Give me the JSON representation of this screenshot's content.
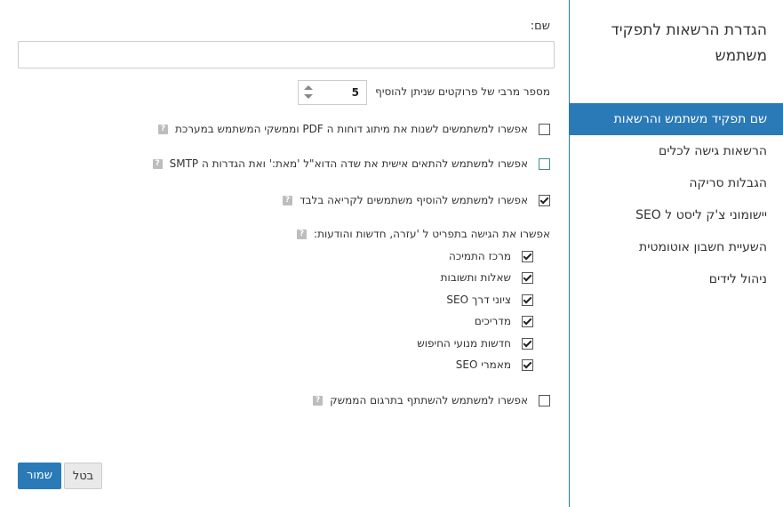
{
  "sidebar": {
    "title": "הגדרת הרשאות לתפקיד משתמש",
    "items": [
      {
        "label": "שם תפקיד משתמש והרשאות",
        "active": true
      },
      {
        "label": "הרשאות גישה לכלים",
        "active": false
      },
      {
        "label": "הגבלות סריקה",
        "active": false
      },
      {
        "label": "יישומוני צ'ק ליסט ל SEO",
        "active": false
      },
      {
        "label": "השעיית חשבון אוטומטית",
        "active": false
      },
      {
        "label": "ניהול לידים",
        "active": false
      }
    ]
  },
  "form": {
    "name_label": "שם:",
    "name_value": "",
    "max_projects_label": "מספר מרבי של פרוקטים שניתן להוסיף",
    "max_projects_value": "5",
    "opt_pdf": {
      "label": "אפשרו למשתמשים לשנות את מיתוג דוחות ה PDF וממשקי המשתמש במערכת",
      "checked": false
    },
    "opt_email": {
      "label": "אפשרו למשתמש להתאים אישית את שדה הדוא\"ל 'מאת:' ואת הגדרות ה SMTP",
      "checked": false
    },
    "opt_readonly": {
      "label": "אפשרו למשתמש להוסיף משתמשים לקריאה בלבד",
      "checked": true
    },
    "help_access_label": "אפשרו את הגישה בתפריט ל 'עזרה, חדשות והודעות:",
    "sub_items": [
      {
        "label": "מרכז התמיכה",
        "checked": true
      },
      {
        "label": "שאלות ותשובות",
        "checked": true
      },
      {
        "label": "ציוני דרך SEO",
        "checked": true
      },
      {
        "label": "מדריכים",
        "checked": true
      },
      {
        "label": "חדשות מנועי החיפוש",
        "checked": true
      },
      {
        "label": "מאמרי SEO",
        "checked": true
      }
    ],
    "opt_affiliate": {
      "label": "אפשרו למשתמש להשתתף בתרגום הממשק",
      "checked": false
    },
    "help_icon_glyph": "?"
  },
  "buttons": {
    "save": "שמור",
    "cancel": "בטל"
  },
  "colors": {
    "accent": "#2a7ab8"
  }
}
